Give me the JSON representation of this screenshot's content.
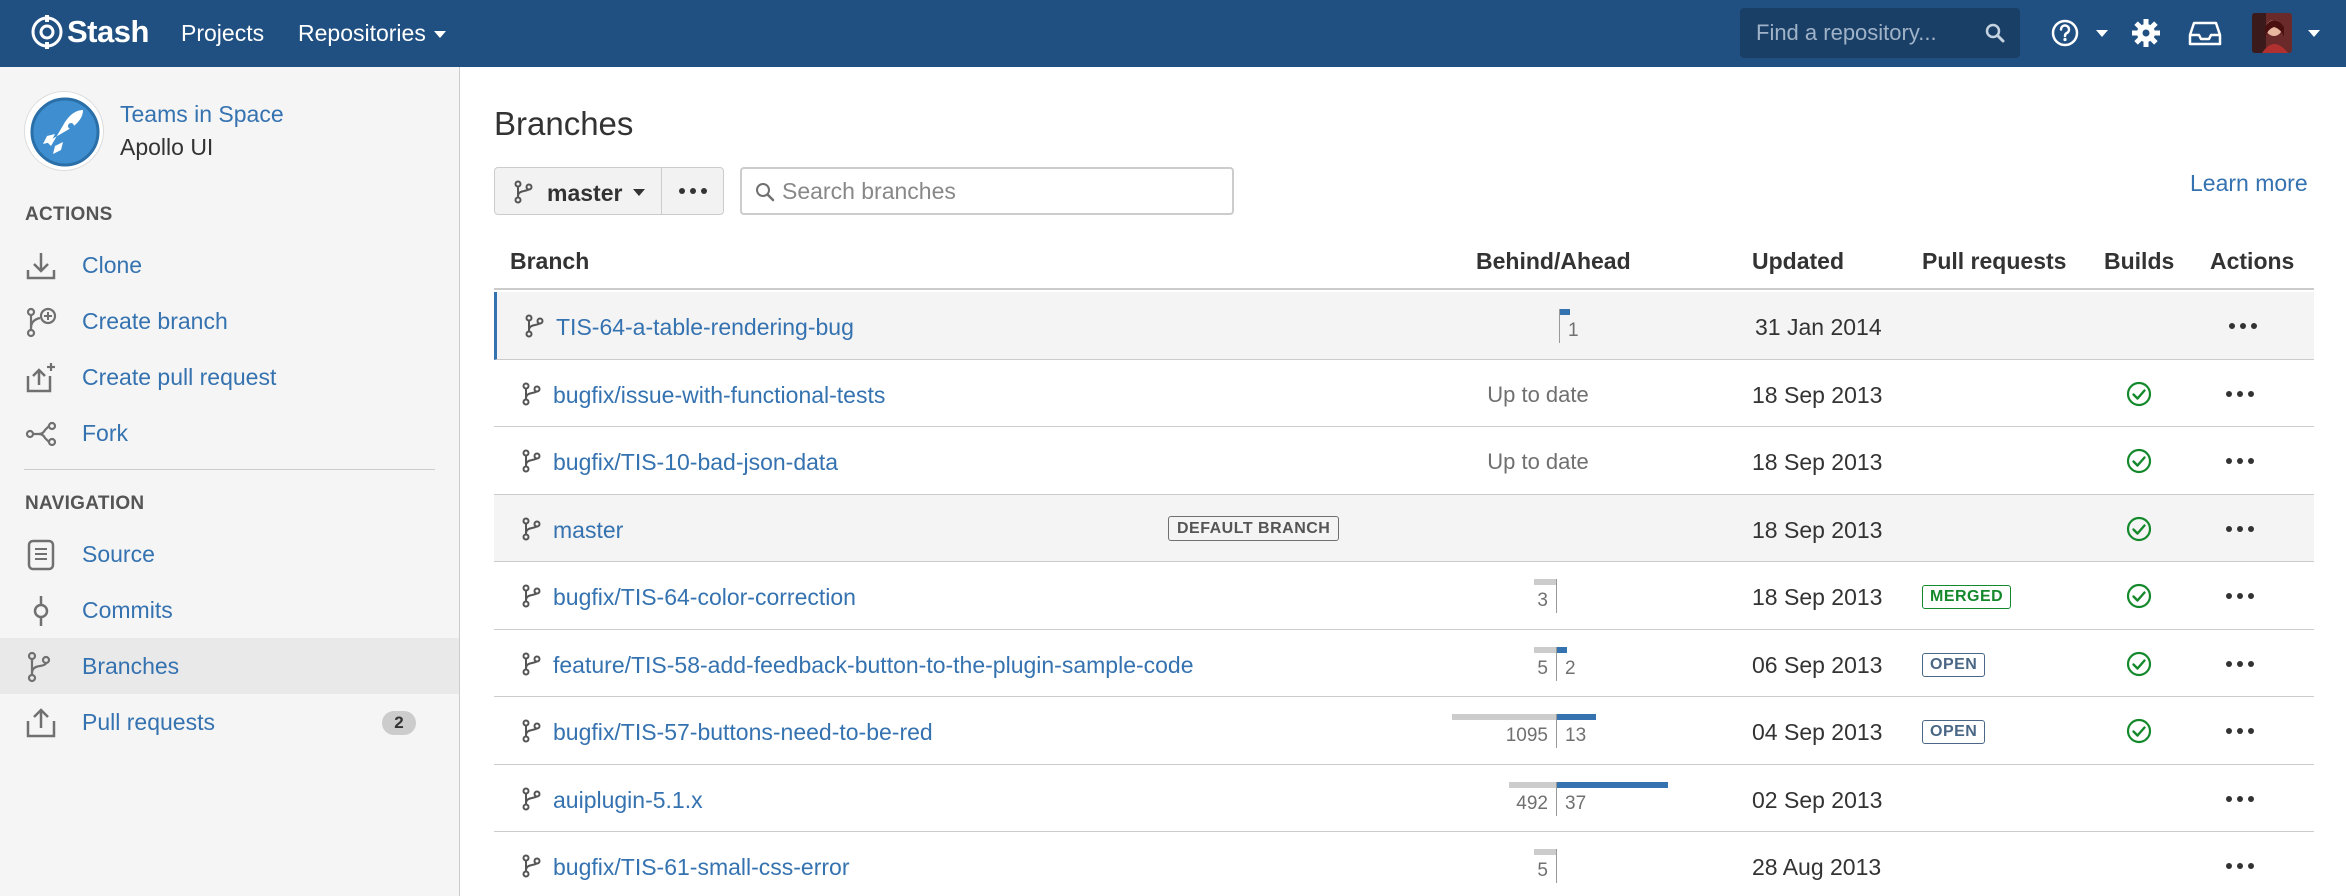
{
  "header": {
    "app_name": "Stash",
    "nav": {
      "projects": "Projects",
      "repositories": "Repositories"
    },
    "search_placeholder": "Find a repository...",
    "colors": {
      "bar": "#205081"
    }
  },
  "sidebar": {
    "project_name": "Teams in Space",
    "repo_name": "Apollo UI",
    "actions_heading": "ACTIONS",
    "actions": [
      {
        "label": "Clone",
        "icon": "clone-icon"
      },
      {
        "label": "Create branch",
        "icon": "create-branch-icon"
      },
      {
        "label": "Create pull request",
        "icon": "create-pull-request-icon"
      },
      {
        "label": "Fork",
        "icon": "fork-icon"
      }
    ],
    "navigation_heading": "NAVIGATION",
    "navigation": [
      {
        "label": "Source",
        "icon": "source-icon"
      },
      {
        "label": "Commits",
        "icon": "commits-icon"
      },
      {
        "label": "Branches",
        "icon": "branches-icon",
        "selected": true
      },
      {
        "label": "Pull requests",
        "icon": "pull-requests-icon",
        "count": "2"
      }
    ]
  },
  "main": {
    "title": "Branches",
    "branch_selector": "master",
    "search_placeholder": "Search branches",
    "learn_more": "Learn more",
    "columns": {
      "branch": "Branch",
      "behind_ahead": "Behind/Ahead",
      "updated": "Updated",
      "pull_requests": "Pull requests",
      "builds": "Builds",
      "actions": "Actions"
    },
    "rows": [
      {
        "name": "TIS-64-a-table-rendering-bug",
        "behind": 0,
        "ahead": 1,
        "behind_label": "",
        "ahead_label": "1",
        "updated": "31 Jan 2014",
        "pr": "",
        "build": false,
        "active": true,
        "highlight": true
      },
      {
        "name": "bugfix/issue-with-functional-tests",
        "status": "Up to date",
        "updated": "18 Sep 2013",
        "pr": "",
        "build": true
      },
      {
        "name": "bugfix/TIS-10-bad-json-data",
        "status": "Up to date",
        "updated": "18 Sep 2013",
        "pr": "",
        "build": true
      },
      {
        "name": "master",
        "default_label": "DEFAULT BRANCH",
        "updated": "18 Sep 2013",
        "pr": "",
        "build": true,
        "highlight": true
      },
      {
        "name": "bugfix/TIS-64-color-correction",
        "behind": 3,
        "ahead": 0,
        "behind_label": "3",
        "ahead_label": "",
        "updated": "18 Sep 2013",
        "pr": "MERGED",
        "build": true
      },
      {
        "name": "feature/TIS-58-add-feedback-button-to-the-plugin-sample-code",
        "behind": 5,
        "ahead": 2,
        "behind_label": "5",
        "ahead_label": "2",
        "updated": "06 Sep 2013",
        "pr": "OPEN",
        "build": true
      },
      {
        "name": "bugfix/TIS-57-buttons-need-to-be-red",
        "behind": 1095,
        "ahead": 13,
        "behind_label": "1095",
        "ahead_label": "13",
        "updated": "04 Sep 2013",
        "pr": "OPEN",
        "build": true
      },
      {
        "name": "auiplugin-5.1.x",
        "behind": 492,
        "ahead": 37,
        "behind_label": "492",
        "ahead_label": "37",
        "updated": "02 Sep 2013",
        "pr": "",
        "build": false
      },
      {
        "name": "bugfix/TIS-61-small-css-error",
        "behind": 5,
        "ahead": 0,
        "behind_label": "5",
        "ahead_label": "",
        "updated": "28 Aug 2013",
        "pr": "",
        "build": false
      }
    ]
  }
}
